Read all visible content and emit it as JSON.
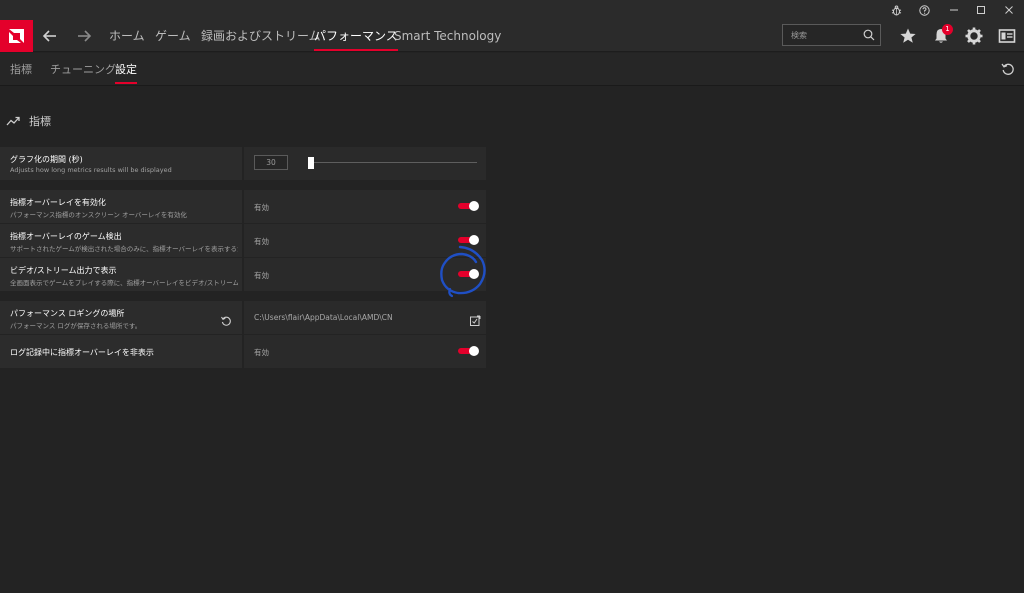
{
  "nav": {
    "items": [
      {
        "label": "ホーム"
      },
      {
        "label": "ゲーム"
      },
      {
        "label": "録画およびストリーム"
      },
      {
        "label": "パフォーマンス"
      },
      {
        "label": "Smart Technology"
      }
    ],
    "search_placeholder": "検索",
    "notification_count": "1"
  },
  "subnav": {
    "items": [
      {
        "label": "指標"
      },
      {
        "label": "チューニング"
      },
      {
        "label": "設定"
      }
    ]
  },
  "section": {
    "title": "指標"
  },
  "settings": {
    "graph_period": {
      "label": "グラフ化の期間 (秒)",
      "desc": "Adjusts how long metrics results will be displayed",
      "value": "30",
      "slider_fraction": 0.0
    },
    "overlay_enable": {
      "label": "指標オーバーレイを有効化",
      "desc": "パフォーマンス指標のオンスクリーン オーバーレイを有効化",
      "value": "有効",
      "on": true
    },
    "overlay_game_detect": {
      "label": "指標オーバーレイのゲーム検出",
      "desc": "サポートされたゲームが検出された場合のみに、指標オーバーレイを表示するかど...",
      "value": "有効",
      "on": true
    },
    "video_stream_output": {
      "label": "ビデオ/ストリーム出力で表示",
      "desc": "全画面表示でゲームをプレイする際に、指標オーバーレイをビデオ/ストリーム出力...",
      "value": "有効",
      "on": true
    },
    "log_location": {
      "label": "パフォーマンス ロギングの場所",
      "desc": "パフォーマンス ログが保存される場所です。",
      "value": "C:\\Users\\flair\\AppData\\Local\\AMD\\CN"
    },
    "hide_overlay_logging": {
      "label": "ログ記録中に指標オーバーレイを非表示",
      "value": "有効",
      "on": true
    }
  },
  "colors": {
    "accent": "#e4002b",
    "background": "#232323",
    "panel": "#2c2c2c",
    "annotation": "#1f4fc4"
  },
  "icons": {
    "logo": "amd-logo",
    "back": "arrow-left-icon",
    "forward": "arrow-right-icon",
    "search": "search-icon",
    "favorite": "star-icon",
    "notifications": "bell-icon",
    "settings": "gear-icon",
    "account": "profile-card-icon",
    "bug": "bug-icon",
    "help": "help-icon",
    "reset": "reset-icon",
    "browse": "browse-icon",
    "metrics": "trend-icon"
  }
}
